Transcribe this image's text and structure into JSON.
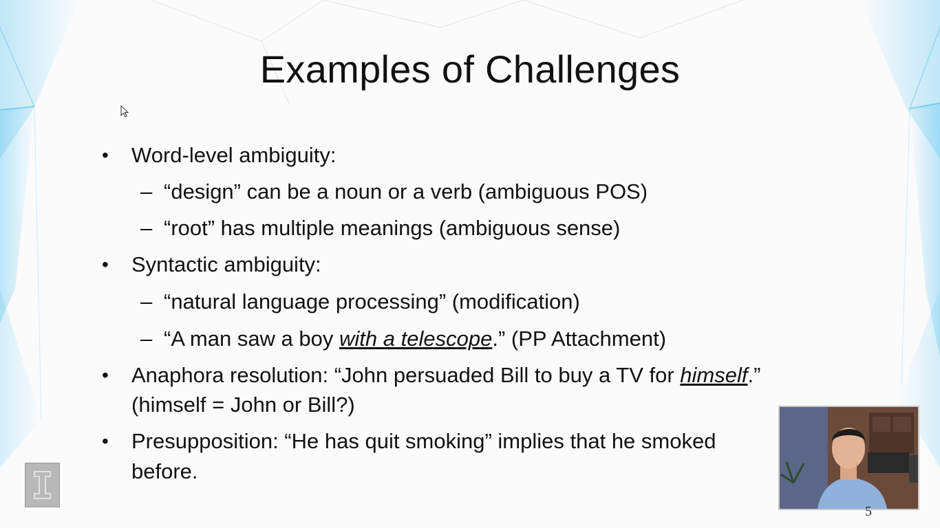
{
  "slide": {
    "title": "Examples of Challenges",
    "page_number": "5"
  },
  "bullets": [
    {
      "text": "Word-level ambiguity:",
      "subitems": [
        "“design” can be a noun or a verb (ambiguous POS)",
        "“root” has multiple meanings (ambiguous sense)"
      ]
    },
    {
      "text": "Syntactic ambiguity:",
      "subitems": [
        "“natural language processing” (modification)"
      ],
      "subitem2_before": "“A man saw a boy ",
      "subitem2_emph": "with a telescope",
      "subitem2_after": ".” (PP Attachment)"
    },
    {
      "text_before": "Anaphora resolution: “John persuaded Bill to buy a TV for ",
      "text_emph": "himself",
      "text_after": ".”",
      "continuation": "(himself = John or Bill?)"
    },
    {
      "text": "Presupposition: “He has quit smoking” implies that he smoked",
      "continuation": "before."
    }
  ],
  "icons": {
    "bullet": "bullet-dot",
    "dash": "en-dash",
    "logo": "illinois-block-i-logo",
    "cursor": "mouse-cursor-icon"
  },
  "colors": {
    "background": "#fbfbfc",
    "accent_blue": "#7fd0f2",
    "text": "#111111"
  }
}
